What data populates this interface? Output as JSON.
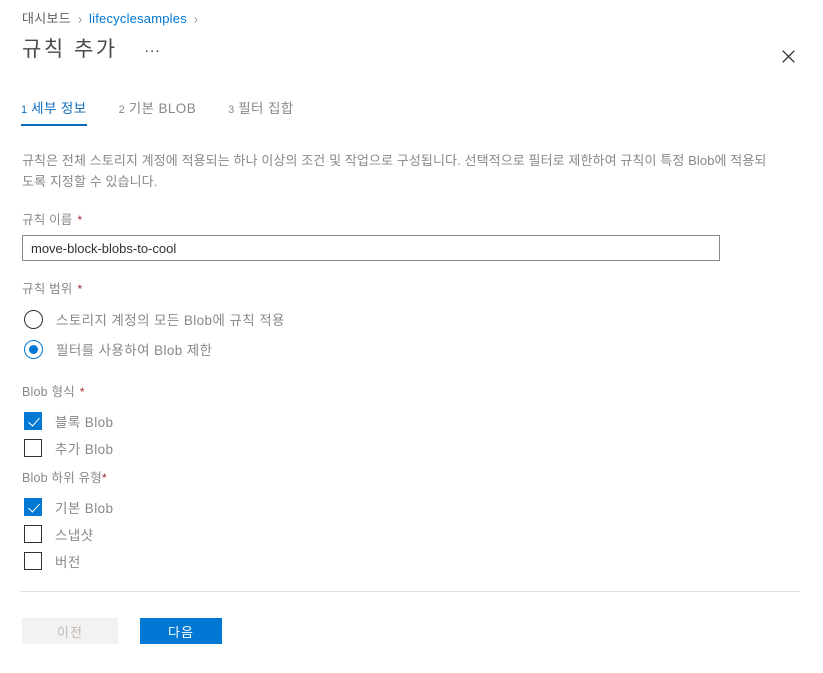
{
  "breadcrumb": {
    "items": [
      {
        "label": "대시보드",
        "type": "static"
      },
      {
        "label": "lifecyclesamples",
        "type": "link"
      }
    ],
    "separator": "›"
  },
  "header": {
    "title": "규칙 추가",
    "more_label": "…",
    "close_label": "닫기"
  },
  "tabs": [
    {
      "number": "1",
      "label": "세부 정보",
      "active": true
    },
    {
      "number": "2",
      "label": "기본 BLOB",
      "active": false
    },
    {
      "number": "3",
      "label": "필터 집합",
      "active": false
    }
  ],
  "description": "규칙은 전체 스토리지 계정에 적용되는 하나 이상의 조건 및 작업으로 구성됩니다. 선택적으로 필터로 제한하여 규칙이 특정 Blob에 적용되도록 지정할 수 있습니다.",
  "rule_name": {
    "label": "규칙 이름",
    "required_mark": "*",
    "value": "move-block-blobs-to-cool",
    "placeholder": ""
  },
  "rule_scope": {
    "label": "규칙 범위",
    "required_mark": "*",
    "options": [
      {
        "label": "스토리지 계정의 모든 Blob에 규칙 적용",
        "selected": false
      },
      {
        "label": "필터를 사용하여 Blob 제한",
        "selected": true
      }
    ]
  },
  "blob_type": {
    "label": "Blob 형식",
    "required_mark": "*",
    "options": [
      {
        "label": "블록 Blob",
        "checked": true
      },
      {
        "label": "추가 Blob",
        "checked": false
      }
    ]
  },
  "blob_subtype": {
    "label": "Blob 하위 유형",
    "required_mark": "*",
    "options": [
      {
        "label": "기본 Blob",
        "checked": true
      },
      {
        "label": "스냅샷",
        "checked": false
      },
      {
        "label": "버전",
        "checked": false
      }
    ]
  },
  "footer": {
    "back_label": "이전",
    "next_label": "다음"
  },
  "colors": {
    "accent": "#0078D4",
    "tab_active": "#0F6CBD",
    "link": "#0078D4",
    "required": "#A4262C",
    "muted_text": "#8A8886",
    "divider": "#E1DFDD",
    "disabled_bg": "#F3F2F1"
  }
}
